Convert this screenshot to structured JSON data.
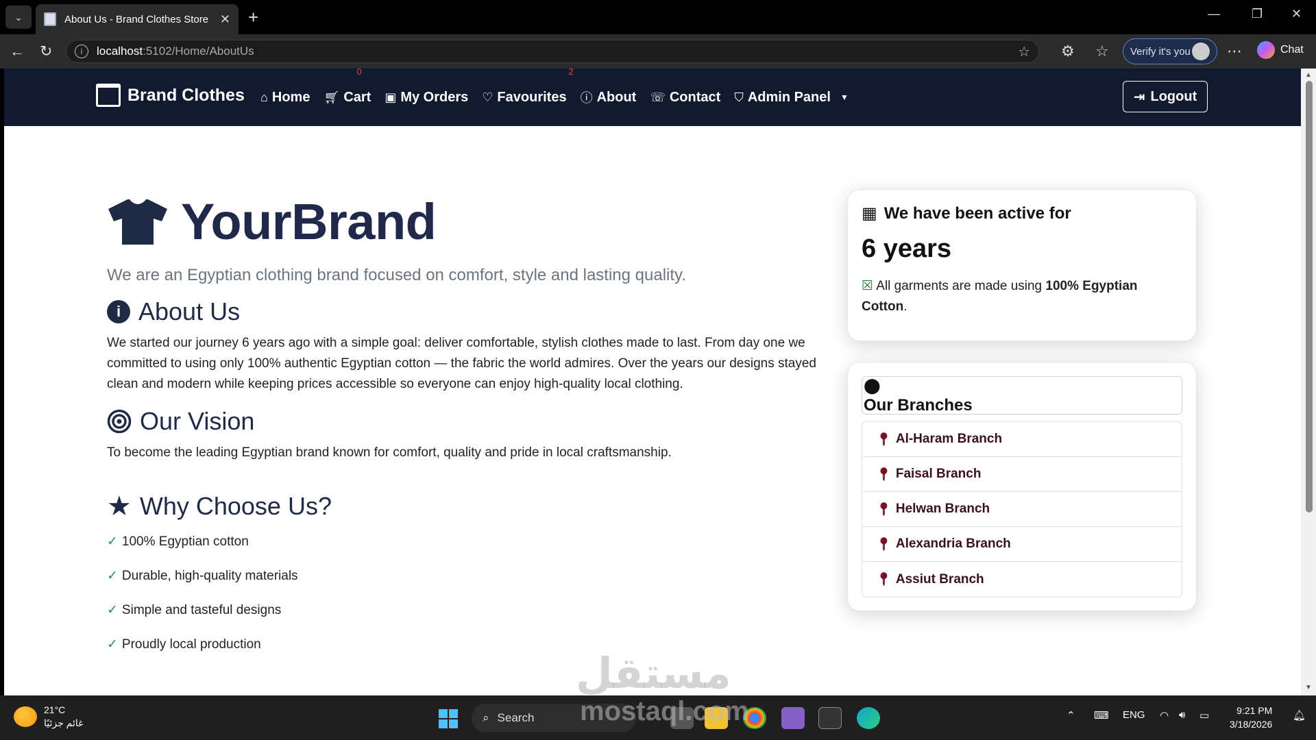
{
  "browser": {
    "tab_title": "About Us - Brand Clothes Store",
    "url_host": "localhost",
    "url_path": ":5102/Home/AboutUs",
    "verify_label": "Verify it's you",
    "chat_label": "Chat"
  },
  "nav": {
    "brand": "Brand Clothes",
    "items": [
      {
        "label": "Home",
        "icon": "house-icon"
      },
      {
        "label": "Cart",
        "icon": "cart-icon",
        "badge": "0"
      },
      {
        "label": "My Orders",
        "icon": "bag-icon"
      },
      {
        "label": "Favourites",
        "icon": "heart-icon",
        "badge": "2"
      },
      {
        "label": "About",
        "icon": "info-icon"
      },
      {
        "label": "Contact",
        "icon": "phone-icon"
      },
      {
        "label": "Admin Panel",
        "icon": "shield-icon"
      }
    ],
    "logout": "Logout"
  },
  "hero": {
    "title": "YourBrand",
    "tagline": "We are an Egyptian clothing brand focused on comfort, style and lasting quality."
  },
  "about": {
    "heading": "About Us",
    "body": "We started our journey 6 years ago with a simple goal: deliver comfortable, stylish clothes made to last. From day one we committed to using only 100% authentic Egyptian cotton — the fabric the world admires. Over the years our designs stayed clean and modern while keeping prices accessible so everyone can enjoy high-quality local clothing."
  },
  "vision": {
    "heading": "Our Vision",
    "body": "To become the leading Egyptian brand known for comfort, quality and pride in local craftsmanship."
  },
  "why": {
    "heading": "Why Choose Us?",
    "items": [
      "100% Egyptian cotton",
      "Durable, high-quality materials",
      "Simple and tasteful designs",
      "Proudly local production"
    ]
  },
  "active_card": {
    "heading": "We have been active for",
    "years": "6 years",
    "note_prefix": "All garments are made using",
    "note_bold": "100% Egyptian Cotton",
    "note_suffix": "."
  },
  "branches": {
    "heading": "Our Branches",
    "items": [
      "Al-Haram Branch",
      "Faisal Branch",
      "Helwan Branch",
      "Alexandria Branch",
      "Assiut Branch"
    ]
  },
  "taskbar": {
    "temp": "21°C",
    "weather": "غائم جزئيًا",
    "search": "Search",
    "lang": "ENG",
    "time": "9:21 PM",
    "date": "3/18/2026"
  },
  "watermark": {
    "arabic": "مستقل",
    "latin": "mostaql.com"
  },
  "colors": {
    "navbar": "#111a2e",
    "heading": "#1f2a44",
    "check": "#2e8b57",
    "branch_pin": "#7a0f24"
  }
}
